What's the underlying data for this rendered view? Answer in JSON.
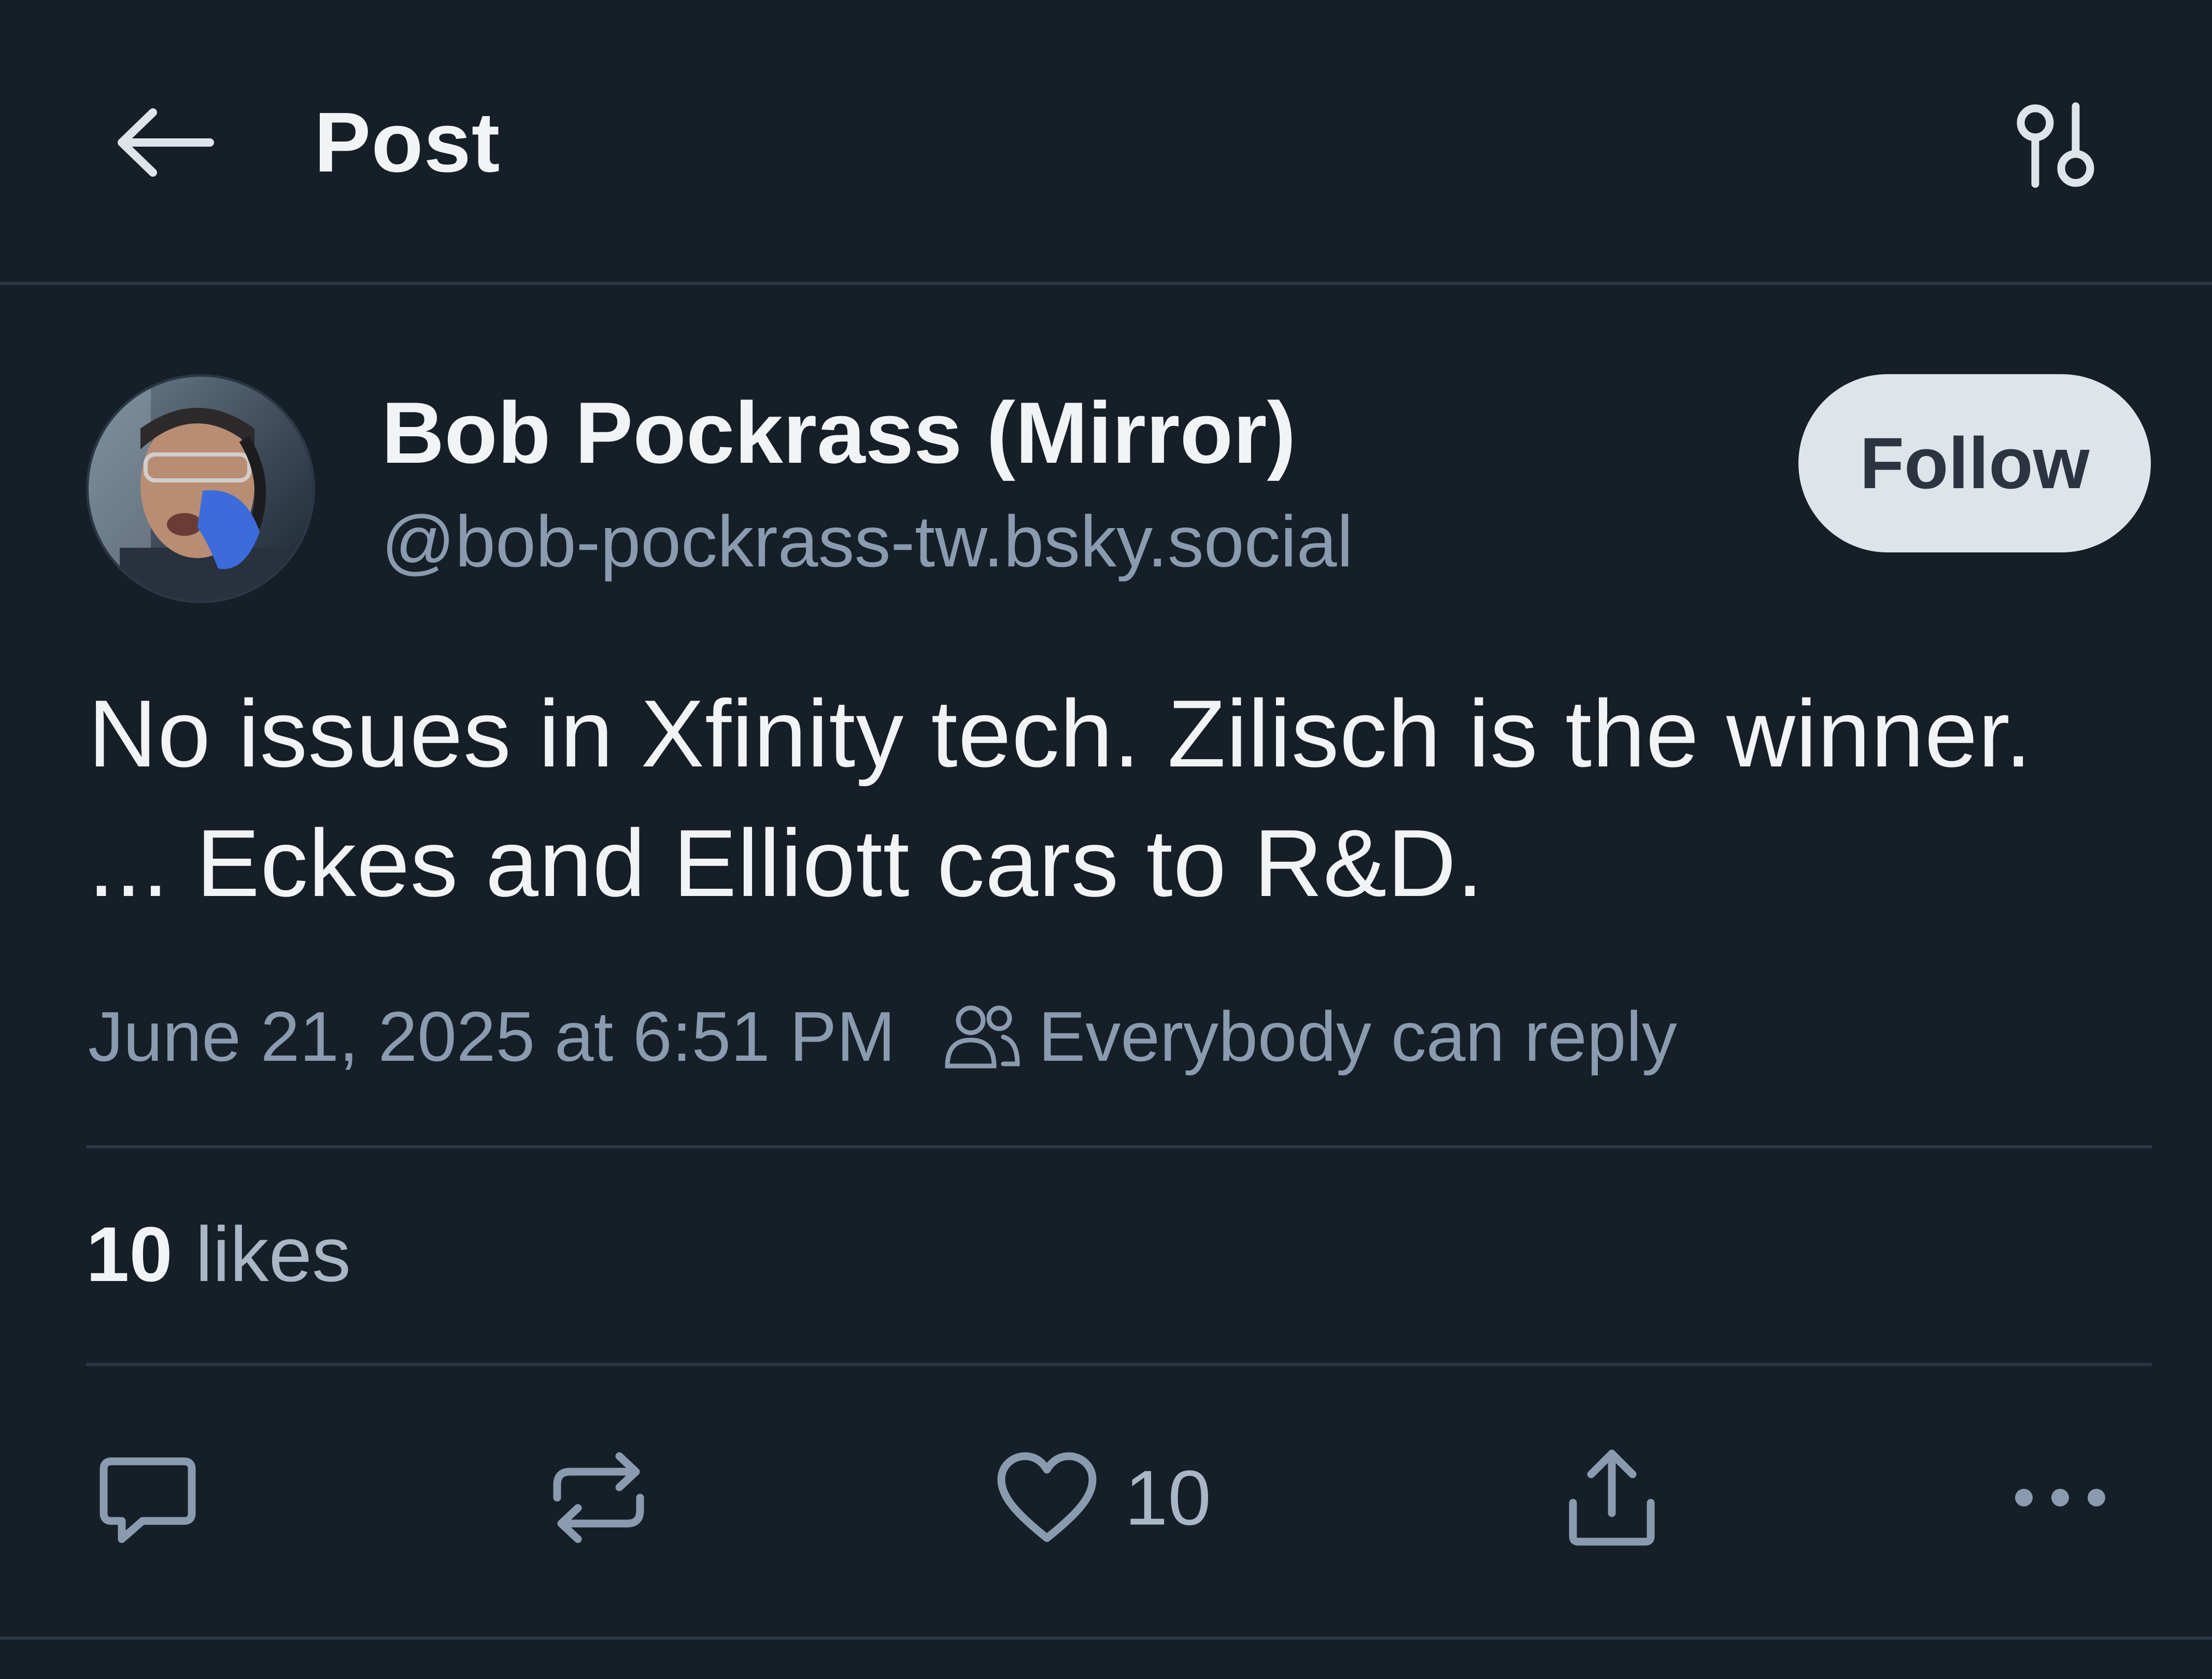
{
  "header": {
    "title": "Post",
    "back_icon": "arrow-left-icon",
    "options_icon": "sliders-icon"
  },
  "post": {
    "author": {
      "display_name": "Bob Pockrass (Mirror)",
      "handle": "@bob-pockrass-tw.bsky.social",
      "avatar_icon": "avatar-photo"
    },
    "follow_label": "Follow",
    "text": "No issues in Xfinity tech. Zilisch is the winner. ... Eckes and Elliott cars to R&D.",
    "timestamp": "June 21, 2025 at 6:51 PM",
    "reply_setting": "Everybody can reply",
    "likes": {
      "count": "10",
      "label": "likes"
    }
  },
  "actions": {
    "reply_icon": "comment-icon",
    "repost_icon": "repost-icon",
    "like_icon": "heart-icon",
    "like_count": "10",
    "share_icon": "share-icon",
    "more_icon": "more-dots-icon"
  },
  "colors": {
    "background": "#161e27",
    "primary_text": "#f1f3f5",
    "secondary_text": "#8a9bb0",
    "divider": "#2a3745",
    "follow_button_bg": "#dfe3ea"
  }
}
